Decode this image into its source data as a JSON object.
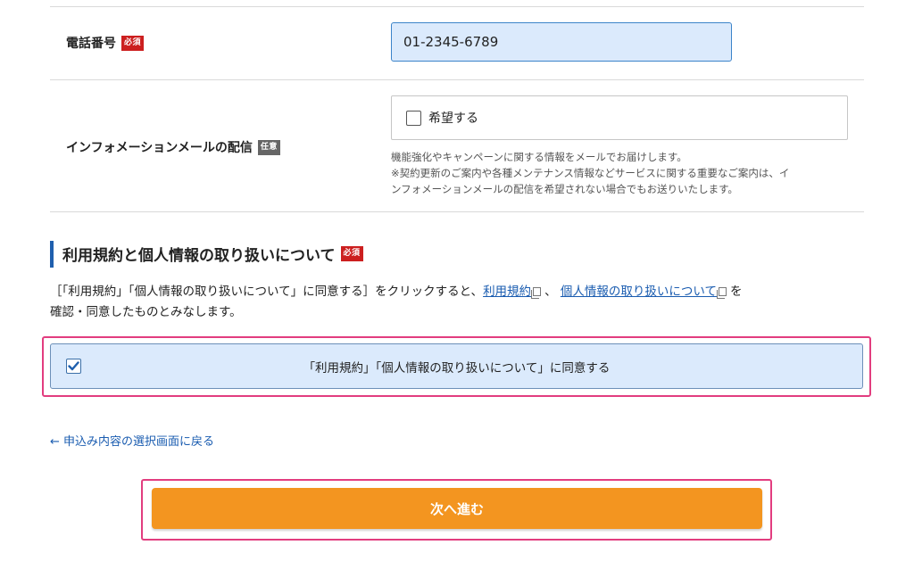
{
  "form": {
    "phone": {
      "label": "電話番号",
      "badge": "必須",
      "value": "01-2345-6789"
    },
    "info_mail": {
      "label": "インフォメーションメールの配信",
      "badge": "任意",
      "option_label": "希望する",
      "checked": false,
      "note_line1": "機能強化やキャンペーンに関する情報をメールでお届けします。",
      "note_line2": "※契約更新のご案内や各種メンテナンス情報などサービスに関する重要なご案内は、イ",
      "note_line3": "ンフォメーションメールの配信を希望されない場合でもお送りいたします。"
    }
  },
  "terms": {
    "title": "利用規約と個人情報の取り扱いについて",
    "badge": "必須",
    "text_prefix": "［「利用規約」「個人情報の取り扱いについて」に同意する］をクリックすると、",
    "link1": "利用規約",
    "separator": "、",
    "link2": "個人情報の取り扱いについて",
    "text_suffix": "を",
    "text_line2": "確認・同意したものとみなします。",
    "agree_label": "「利用規約」「個人情報の取り扱いについて」に同意する",
    "agree_checked": true
  },
  "nav": {
    "back_link": "← 申込み内容の選択画面に戻る",
    "next_button": "次へ進む"
  },
  "colors": {
    "required_badge": "#cc1f1f",
    "optional_badge": "#666666",
    "accent_blue": "#1f5fae",
    "input_bg": "#dbeafc",
    "highlight": "#e23d7f",
    "next_button": "#f39520"
  }
}
